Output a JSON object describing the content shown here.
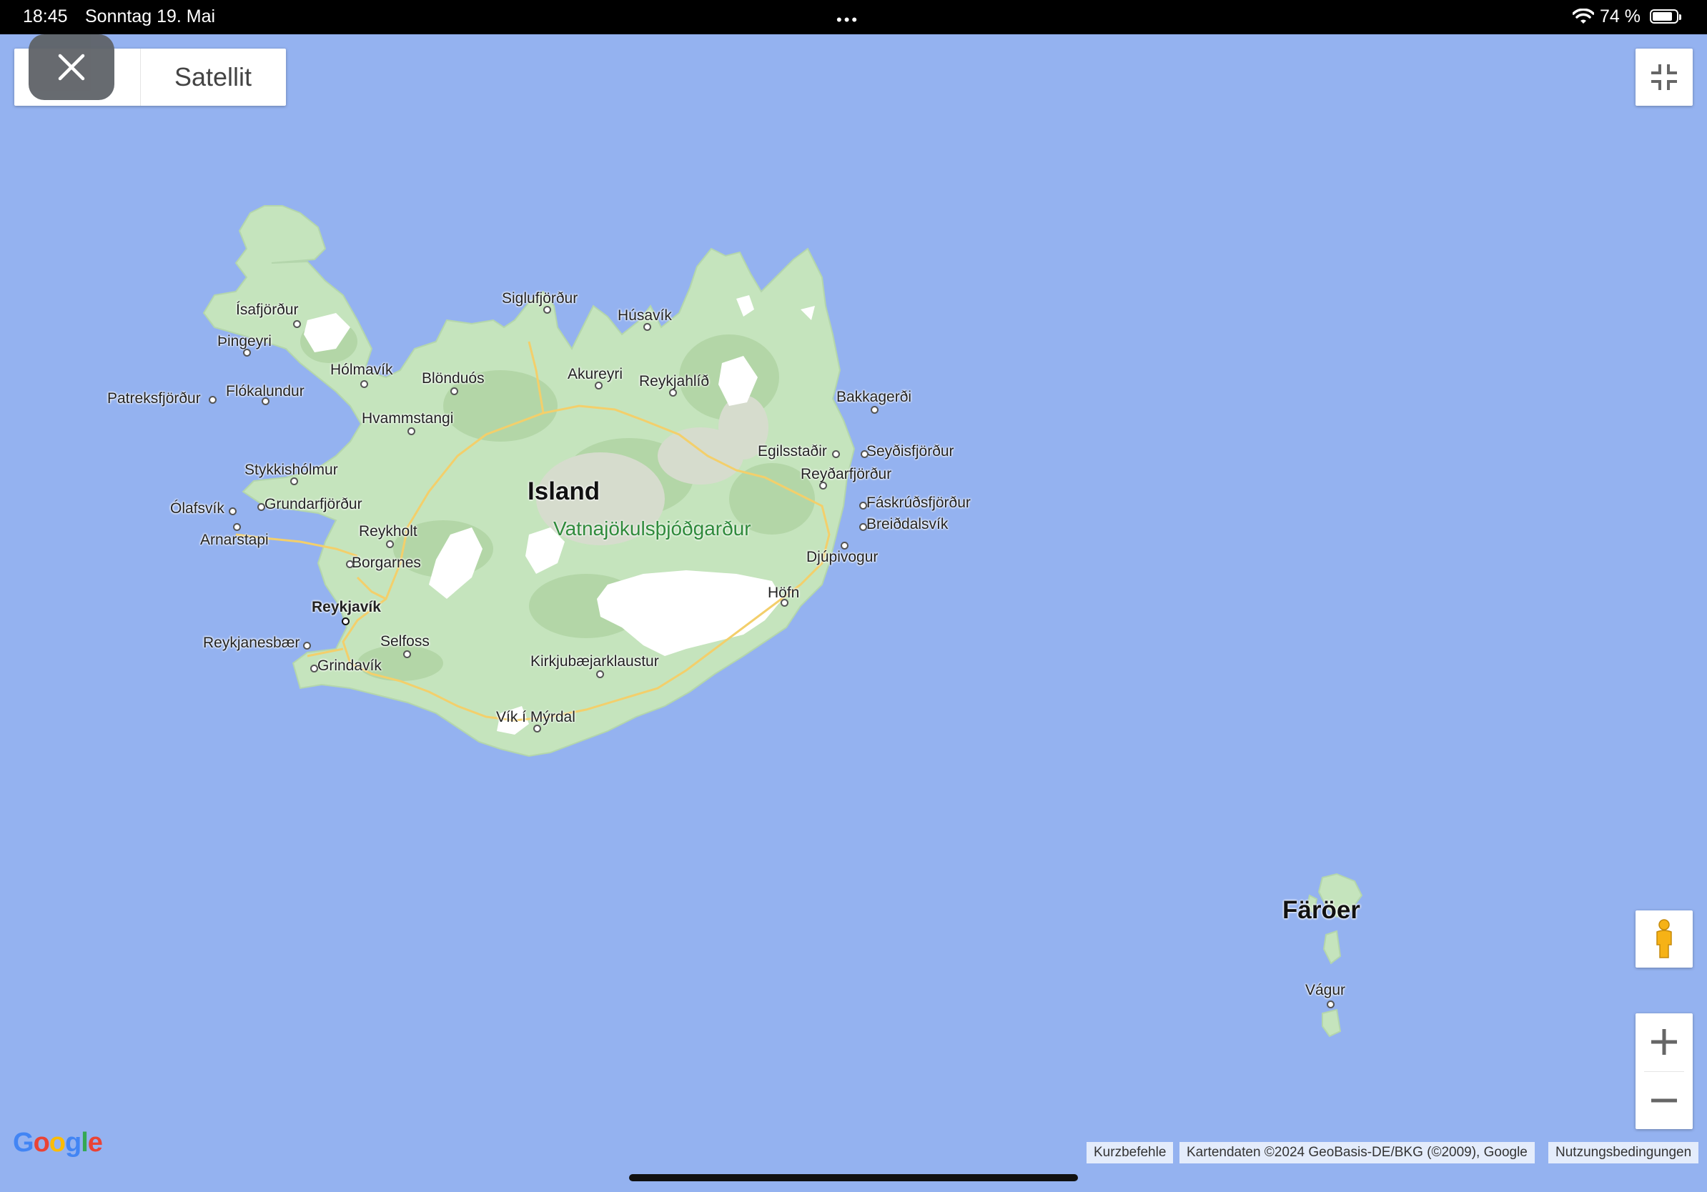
{
  "status_bar": {
    "time": "18:45",
    "date": "Sonntag 19. Mai",
    "dots": "•••",
    "battery": "74 %"
  },
  "map": {
    "colors": {
      "water": "#94b2f0",
      "land": "#c8e6c0",
      "glacier": "#ffffff",
      "road": "#f5d37a"
    },
    "labels": {
      "country_main": "Island",
      "country_faroe": "Färöer",
      "park": "Vatnajökulsþjóðgarður",
      "isafjordur": "Ísafjörður",
      "thingeyri": "Þingeyri",
      "patreksfjordur": "Patreksfjörður",
      "flokalundur": "Flókalundur",
      "holmavik": "Hólmavík",
      "blonduos": "Blönduós",
      "hvammstangi": "Hvammstangi",
      "siglufjordur": "Siglufjörður",
      "husavik": "Húsavík",
      "akureyri": "Akureyri",
      "reykjahlid": "Reykjahlíð",
      "bakkagerdi": "Bakkagerði",
      "egilsstadir": "Egilsstaðir",
      "seydisfjordur": "Seyðisfjörður",
      "reydarfjordur": "Reyðarfjörður",
      "faskrudsfjordur": "Fáskrúðsfjörður",
      "breiddalsvik": "Breiðdalsvík",
      "djupivogur": "Djúpivogur",
      "hofn": "Höfn",
      "stykkisholmur": "Stykkishólmur",
      "olafsvik": "Ólafsvík",
      "grundarfjordur": "Grundarfjörður",
      "arnarstapi": "Arnarstapi",
      "reykholt": "Reykholt",
      "borgarnes": "Borgarnes",
      "reykjavik": "Reykjavík",
      "reykjanesbaer": "Reykjanesbær",
      "grindavik": "Grindavík",
      "selfoss": "Selfoss",
      "kirkjubaejarklaustur": "Kirkjubæjarklaustur",
      "vik": "Vík í Mýrdal",
      "vagur": "Vágur"
    }
  },
  "controls": {
    "map_type_satellite": "Satellit",
    "close_icon": "close-icon",
    "fullscreen_icon": "exit-fullscreen-icon",
    "pegman_icon": "pegman-icon",
    "zoom_in_icon": "plus-icon",
    "zoom_out_icon": "minus-icon"
  },
  "footer": {
    "logo": "Google",
    "shortcuts": "Kurzbefehle",
    "map_data": "Kartendaten ©2024 GeoBasis-DE/BKG (©2009), Google",
    "terms": "Nutzungsbedingungen"
  }
}
